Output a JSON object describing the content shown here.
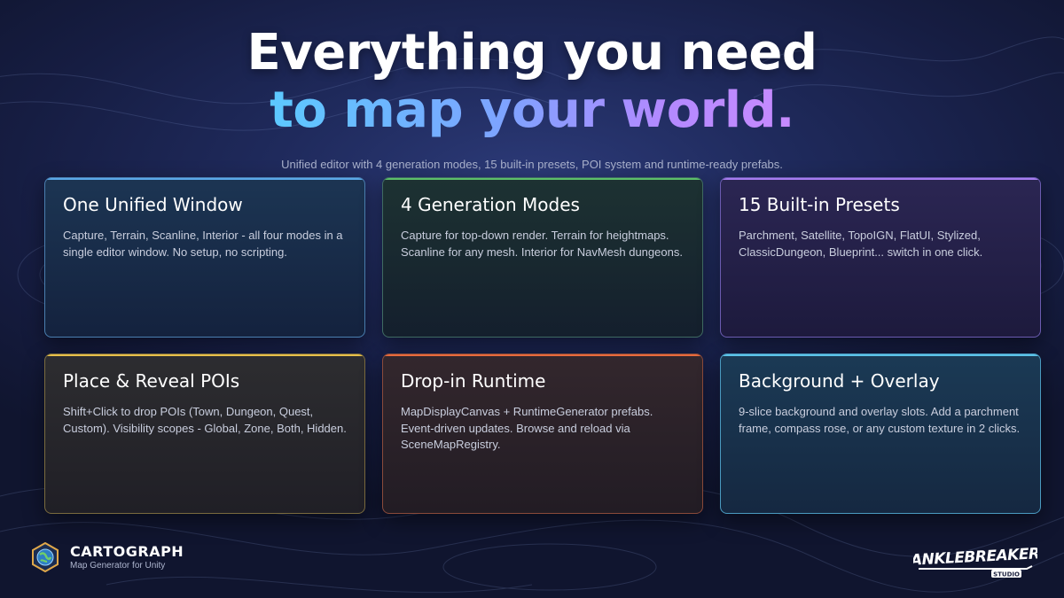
{
  "headline": {
    "line1": "Everything you need",
    "line2": "to map your world."
  },
  "subtitle": "Unified editor with 4 generation modes, 15 built-in presets, POI system and runtime-ready prefabs.",
  "cards": [
    {
      "title": "One Unified Window",
      "body": "Capture, Terrain, Scanline, Interior - all four modes in a single editor window. No setup, no scripting.",
      "accent": "#5aa8e8"
    },
    {
      "title": "4 Generation Modes",
      "body": "Capture for top-down render. Terrain for heightmaps. Scanline for any mesh. Interior for NavMesh dungeons.",
      "accent": "#5cbf6a"
    },
    {
      "title": "15 Built-in Presets",
      "body": "Parchment, Satellite, TopoIGN, FlatUI, Stylized, ClassicDungeon, Blueprint... switch in one click.",
      "accent": "#a67cf0"
    },
    {
      "title": "Place & Reveal POIs",
      "body": "Shift+Click to drop POIs (Town, Dungeon, Quest, Custom). Visibility scopes - Global, Zone, Both, Hidden.",
      "accent": "#e8c04a"
    },
    {
      "title": "Drop-in Runtime",
      "body": "MapDisplayCanvas + RuntimeGenerator prefabs. Event-driven updates. Browse and reload via SceneMapRegistry.",
      "accent": "#e86a3c"
    },
    {
      "title": "Background + Overlay",
      "body": "9-slice background and overlay slots. Add a parchment frame, compass rose, or any custom texture in 2 clicks.",
      "accent": "#5cc4e8"
    }
  ],
  "brand": {
    "name": "CARTOGRAPH",
    "tagline": "Map Generator for Unity"
  },
  "studio": {
    "name": "ANKLEBREAKER",
    "sub": "STUDIO"
  }
}
